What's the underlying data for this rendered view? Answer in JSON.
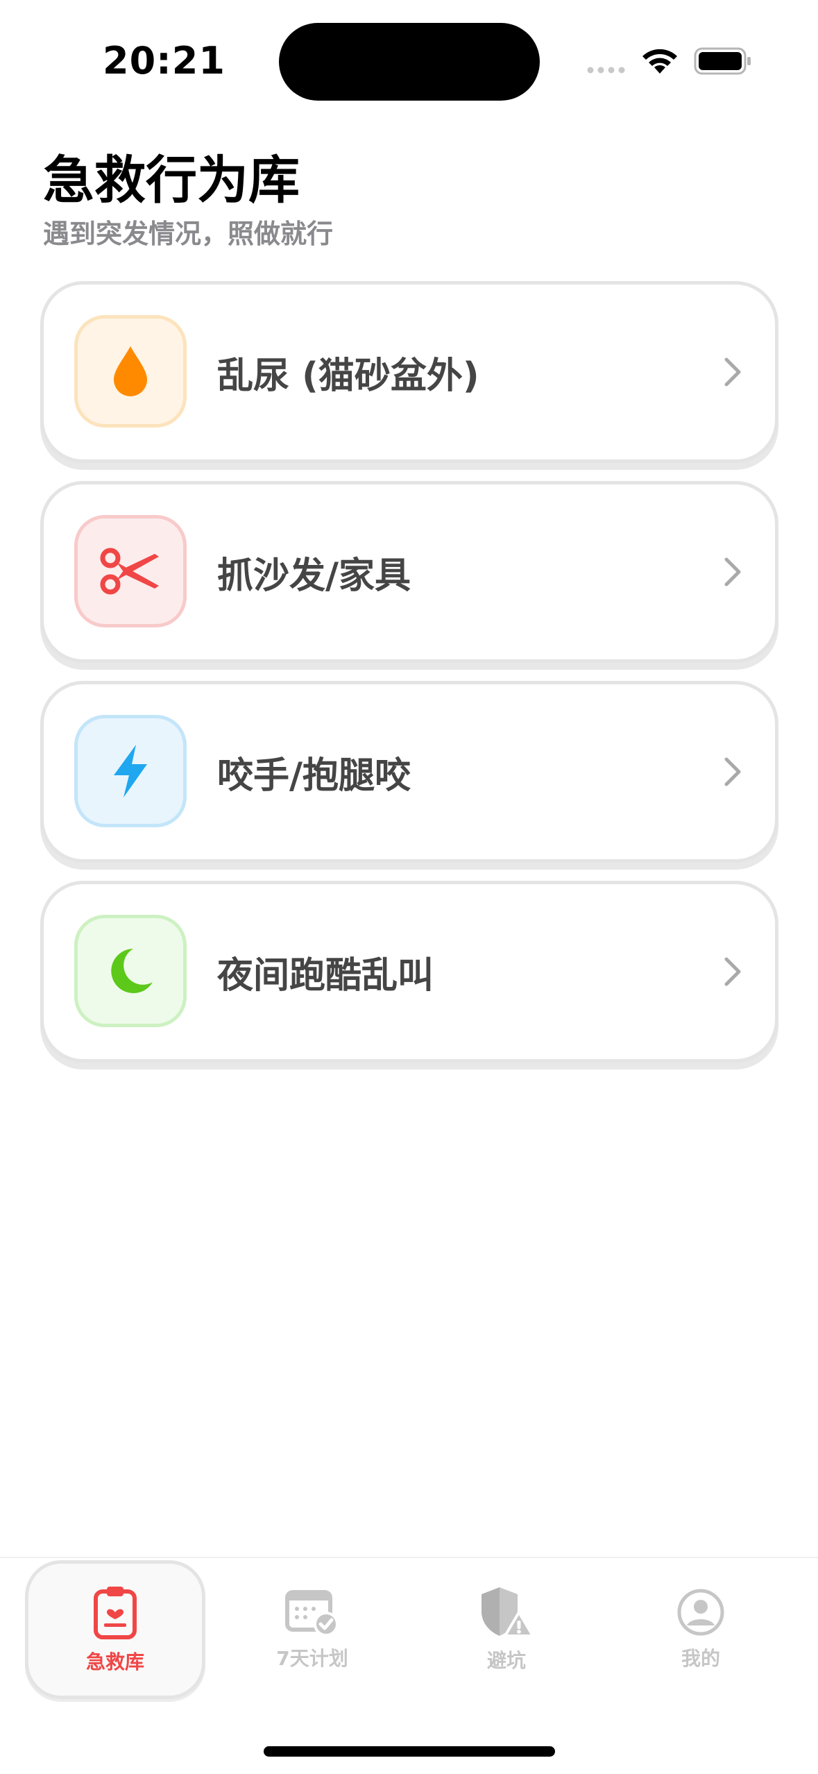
{
  "status_bar": {
    "time": "20:21"
  },
  "header": {
    "title": "急救行为库",
    "subtitle": "遇到突发情况，照做就行"
  },
  "cards": [
    {
      "label": "乱尿 (猫砂盆外)",
      "icon": "water-drop-icon",
      "accent": "#ff8a00"
    },
    {
      "label": "抓沙发/家具",
      "icon": "scissors-icon",
      "accent": "#f04646"
    },
    {
      "label": "咬手/抱腿咬",
      "icon": "lightning-icon",
      "accent": "#1fa7ef"
    },
    {
      "label": "夜间跑酷乱叫",
      "icon": "moon-icon",
      "accent": "#5cc81a"
    }
  ],
  "tabs": [
    {
      "label": "急救库",
      "icon": "clipboard-heart-icon",
      "active": true
    },
    {
      "label": "7天计划",
      "icon": "calendar-check-icon",
      "active": false
    },
    {
      "label": "避坑",
      "icon": "shield-warning-icon",
      "active": false
    },
    {
      "label": "我的",
      "icon": "person-circle-icon",
      "active": false
    }
  ],
  "colors": {
    "accent_active": "#f04646",
    "inactive": "#c6c6c6",
    "text_primary": "#454545",
    "subtitle": "#8a8a8e"
  }
}
